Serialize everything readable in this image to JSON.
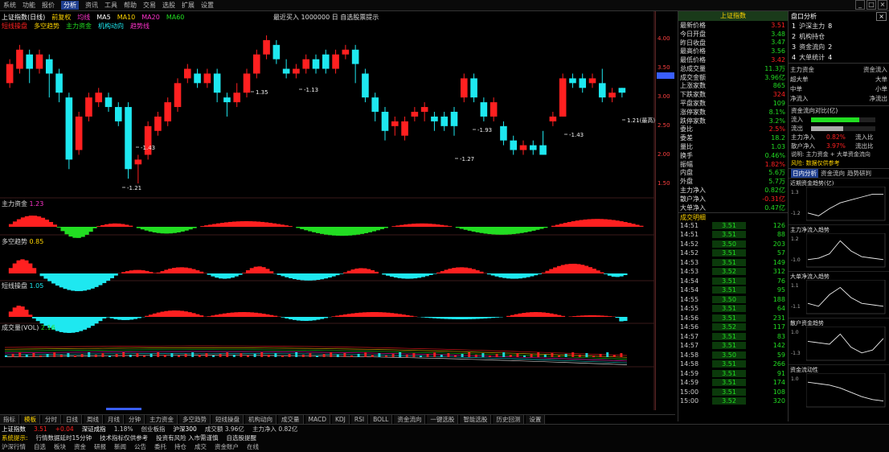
{
  "colors": {
    "up": "#ff2020",
    "down": "#1ee8f0",
    "green": "#22dd22",
    "yellow": "#ffd400",
    "magenta": "#ff33cc",
    "blue": "#3a5fff"
  },
  "topbar": {
    "items": [
      "系统",
      "功能",
      "报价",
      "分析",
      "资讯",
      "工具",
      "帮助",
      "交易",
      "选股",
      "扩展",
      "设置"
    ],
    "active": "分析",
    "window_buttons": [
      "_",
      "□",
      "×"
    ]
  },
  "chart": {
    "head_row1": [
      "上证指数(日线)",
      "前复权",
      "均线",
      "MA5",
      "MA10",
      "MA20",
      "MA60"
    ],
    "head_row2": [
      "短线操盘",
      "多空趋势",
      "主力资金",
      "机构动向",
      "趋势线"
    ],
    "title_center": "最近买入 1000000 日 自选股票提示",
    "candles": [
      {
        "o": 3.3,
        "c": 3.7,
        "h": 3.8,
        "l": 3.2
      },
      {
        "o": 3.6,
        "c": 4.0,
        "h": 4.1,
        "l": 3.5
      },
      {
        "o": 3.9,
        "c": 3.6,
        "h": 4.0,
        "l": 3.3
      },
      {
        "o": 3.6,
        "c": 3.9,
        "h": 4.0,
        "l": 3.5
      },
      {
        "o": 3.8,
        "c": 3.5,
        "h": 3.9,
        "l": 3.0
      },
      {
        "o": 3.5,
        "c": 3.1,
        "h": 3.6,
        "l": 2.9
      },
      {
        "o": 3.0,
        "c": 1.7,
        "h": 3.1,
        "l": 1.5
      },
      {
        "o": 1.9,
        "c": 2.6,
        "h": 2.7,
        "l": 1.8
      },
      {
        "o": 2.6,
        "c": 3.0,
        "h": 3.1,
        "l": 2.5
      },
      {
        "o": 2.9,
        "c": 3.1,
        "h": 3.2,
        "l": 2.8
      },
      {
        "o": 3.0,
        "c": 2.8,
        "h": 3.1,
        "l": 2.7
      },
      {
        "o": 2.8,
        "c": 2.5,
        "h": 2.9,
        "l": 2.4
      },
      {
        "o": 2.8,
        "c": 1.5,
        "h": 2.9,
        "l": 1.3
      },
      {
        "o": 1.6,
        "c": 1.7,
        "h": 1.8,
        "l": 1.2
      },
      {
        "o": 1.8,
        "c": 2.4,
        "h": 2.5,
        "l": 1.7
      },
      {
        "o": 2.3,
        "c": 2.6,
        "h": 2.7,
        "l": 2.2
      },
      {
        "o": 2.5,
        "c": 2.9,
        "h": 3.0,
        "l": 2.4
      },
      {
        "o": 2.8,
        "c": 3.3,
        "h": 3.4,
        "l": 2.7
      },
      {
        "o": 3.4,
        "c": 3.6,
        "h": 3.7,
        "l": 3.3
      },
      {
        "o": 3.5,
        "c": 3.3,
        "h": 3.6,
        "l": 3.2
      },
      {
        "o": 3.3,
        "c": 3.5,
        "h": 3.6,
        "l": 3.2
      },
      {
        "o": 3.5,
        "c": 3.1,
        "h": 3.6,
        "l": 2.9
      },
      {
        "o": 3.0,
        "c": 2.9,
        "h": 3.1,
        "l": 2.6
      },
      {
        "o": 2.9,
        "c": 3.1,
        "h": 3.3,
        "l": 2.8
      },
      {
        "o": 3.1,
        "c": 3.5,
        "h": 3.6,
        "l": 3.0
      },
      {
        "o": 3.5,
        "c": 3.9,
        "h": 4.0,
        "l": 3.4
      },
      {
        "o": 3.9,
        "c": 4.2,
        "h": 4.3,
        "l": 3.8
      },
      {
        "o": 4.1,
        "c": 3.8,
        "h": 4.2,
        "l": 3.7
      },
      {
        "o": 3.6,
        "c": 3.5,
        "h": 3.8,
        "l": 3.4
      },
      {
        "o": 3.5,
        "c": 3.6,
        "h": 3.7,
        "l": 3.4
      },
      {
        "o": 3.6,
        "c": 3.8,
        "h": 3.9,
        "l": 3.5
      },
      {
        "o": 3.8,
        "c": 3.6,
        "h": 3.9,
        "l": 3.5
      },
      {
        "o": 3.9,
        "c": 3.6,
        "h": 4.0,
        "l": 3.5
      },
      {
        "o": 3.6,
        "c": 3.9,
        "h": 4.0,
        "l": 3.5
      },
      {
        "o": 3.9,
        "c": 4.0,
        "h": 4.1,
        "l": 3.8
      },
      {
        "o": 4.0,
        "c": 3.7,
        "h": 4.1,
        "l": 3.3
      },
      {
        "o": 3.5,
        "c": 3.0,
        "h": 3.6,
        "l": 2.9
      },
      {
        "o": 3.0,
        "c": 2.7,
        "h": 3.1,
        "l": 2.5
      },
      {
        "o": 2.7,
        "c": 2.3,
        "h": 2.8,
        "l": 2.1
      },
      {
        "o": 2.4,
        "c": 2.5,
        "h": 2.6,
        "l": 2.2
      },
      {
        "o": 2.2,
        "c": 2.5,
        "h": 2.6,
        "l": 2.1
      },
      {
        "o": 2.6,
        "c": 2.7,
        "h": 2.8,
        "l": 2.5
      },
      {
        "o": 2.7,
        "c": 2.8,
        "h": 2.9,
        "l": 2.5
      },
      {
        "o": 2.6,
        "c": 2.5,
        "h": 2.7,
        "l": 2.3
      },
      {
        "o": 2.6,
        "c": 2.4,
        "h": 2.7,
        "l": 2.3
      },
      {
        "o": 2.7,
        "c": 2.4,
        "h": 2.8,
        "l": 2.2
      },
      {
        "o": 3.0,
        "c": 3.4,
        "h": 3.5,
        "l": 2.9
      },
      {
        "o": 3.4,
        "c": 3.0,
        "h": 3.5,
        "l": 2.9
      },
      {
        "o": 2.9,
        "c": 2.6,
        "h": 3.0,
        "l": 2.5
      },
      {
        "o": 2.6,
        "c": 2.9,
        "h": 3.0,
        "l": 2.5
      },
      {
        "o": 2.4,
        "c": 2.1,
        "h": 2.5,
        "l": 2.0
      },
      {
        "o": 2.1,
        "c": 1.9,
        "h": 2.2,
        "l": 1.8
      },
      {
        "o": 1.9,
        "c": 2.0,
        "h": 2.1,
        "l": 1.8
      },
      {
        "o": 2.0,
        "c": 1.9,
        "h": 2.1,
        "l": 1.8
      },
      {
        "o": 2.0,
        "c": 1.8,
        "h": 2.3,
        "l": 1.8
      },
      {
        "o": 2.5,
        "c": 2.6,
        "h": 2.7,
        "l": 2.4
      },
      {
        "o": 2.6,
        "c": 3.4,
        "h": 3.5,
        "l": 2.6
      },
      {
        "o": 3.4,
        "c": 3.3,
        "h": 3.5,
        "l": 3.2
      },
      {
        "o": 3.4,
        "c": 3.2,
        "h": 3.5,
        "l": 3.1
      },
      {
        "o": 3.3,
        "c": 3.4,
        "h": 3.5,
        "l": 3.2
      },
      {
        "o": 3.3,
        "c": 3.0,
        "h": 3.6,
        "l": 2.9
      },
      {
        "o": 3.0,
        "c": 3.1,
        "h": 3.2,
        "l": 2.9
      },
      {
        "o": 3.2,
        "c": 3.1,
        "h": 3.2,
        "l": 3.0
      }
    ],
    "labels": [
      "-1.21",
      "-1.43",
      "1.35",
      "-1.13",
      "-1.27",
      "-1.93",
      "-1.43",
      "1.21(最高)"
    ],
    "sub_labels": [
      "主力资金",
      "多空趋势",
      "短线操盘",
      "成交量(VOL)"
    ],
    "sub_values": [
      "1.23",
      "0.85",
      "1.05",
      "2.16"
    ]
  },
  "price_axis": {
    "ticks": [
      "4.00",
      "3.50",
      "3.00",
      "2.50",
      "2.00",
      "1.50"
    ]
  },
  "mid_panel": {
    "header": "上证指数",
    "info_rows": [
      {
        "k": "最新价格",
        "v": "3.51"
      },
      {
        "k": "今日开盘",
        "v": "3.48"
      },
      {
        "k": "昨日收盘",
        "v": "3.47"
      },
      {
        "k": "最高价格",
        "v": "3.56"
      },
      {
        "k": "最低价格",
        "v": "3.42"
      },
      {
        "k": "总成交量",
        "v": "11.3万"
      },
      {
        "k": "成交金额",
        "v": "3.96亿"
      },
      {
        "k": "上涨家数",
        "v": "865"
      },
      {
        "k": "下跌家数",
        "v": "324"
      },
      {
        "k": "平盘家数",
        "v": "109"
      },
      {
        "k": "涨停家数",
        "v": "8.1%"
      },
      {
        "k": "跌停家数",
        "v": "3.2%"
      },
      {
        "k": "委比",
        "v": "2.5%"
      },
      {
        "k": "委差",
        "v": "18.2"
      },
      {
        "k": "量比",
        "v": "1.03"
      },
      {
        "k": "换手",
        "v": "0.46%"
      },
      {
        "k": "振幅",
        "v": "1.82%"
      },
      {
        "k": "内盘",
        "v": "5.6万"
      },
      {
        "k": "外盘",
        "v": "5.7万"
      },
      {
        "k": "主力净入",
        "v": "0.82亿"
      },
      {
        "k": "散户净入",
        "v": "-0.31亿"
      },
      {
        "k": "大单净入",
        "v": "0.47亿"
      }
    ],
    "trade_header": "成交明细",
    "trades": [
      {
        "t": "14:51",
        "p": "3.51",
        "v": "126"
      },
      {
        "t": "14:51",
        "p": "3.51",
        "v": "88"
      },
      {
        "t": "14:52",
        "p": "3.50",
        "v": "203"
      },
      {
        "t": "14:52",
        "p": "3.51",
        "v": "57"
      },
      {
        "t": "14:53",
        "p": "3.51",
        "v": "149"
      },
      {
        "t": "14:53",
        "p": "3.52",
        "v": "312"
      },
      {
        "t": "14:54",
        "p": "3.51",
        "v": "76"
      },
      {
        "t": "14:54",
        "p": "3.51",
        "v": "95"
      },
      {
        "t": "14:55",
        "p": "3.50",
        "v": "188"
      },
      {
        "t": "14:55",
        "p": "3.51",
        "v": "64"
      },
      {
        "t": "14:56",
        "p": "3.51",
        "v": "231"
      },
      {
        "t": "14:56",
        "p": "3.52",
        "v": "117"
      },
      {
        "t": "14:57",
        "p": "3.51",
        "v": "83"
      },
      {
        "t": "14:57",
        "p": "3.51",
        "v": "142"
      },
      {
        "t": "14:58",
        "p": "3.50",
        "v": "59"
      },
      {
        "t": "14:58",
        "p": "3.51",
        "v": "266"
      },
      {
        "t": "14:59",
        "p": "3.51",
        "v": "91"
      },
      {
        "t": "14:59",
        "p": "3.51",
        "v": "174"
      },
      {
        "t": "15:00",
        "p": "3.51",
        "v": "108"
      },
      {
        "t": "15:00",
        "p": "3.52",
        "v": "320"
      }
    ],
    "bar_fills": [
      0.2,
      0.9,
      0.4,
      0.1,
      0.15,
      0.35,
      0.6,
      0.25
    ]
  },
  "right_panel": {
    "header": "盘口分析",
    "rank": [
      {
        "n": "1",
        "name": "沪深主力",
        "v": "8"
      },
      {
        "n": "2",
        "name": "机构持仓",
        "v": ""
      },
      {
        "n": "3",
        "name": "资金流向",
        "v": "2"
      },
      {
        "n": "4",
        "name": "大单统计",
        "v": "4"
      }
    ],
    "grid": [
      [
        "主力资金",
        "资金流入"
      ],
      [
        "超大单",
        "大单"
      ],
      [
        "中单",
        "小单"
      ],
      [
        "净流入",
        "净流出"
      ]
    ],
    "bar_title": "资金流向对比(亿)",
    "bars": [
      {
        "label": "流入",
        "fill": 0.75
      },
      {
        "label": "流出",
        "fill": 0.5
      }
    ],
    "stats": [
      {
        "k": "主力净入",
        "v": "0.82%",
        "v2": "流入比"
      },
      {
        "k": "散户净入",
        "v": "3.97%",
        "v2": "流出比"
      }
    ],
    "note1": "说明: 主力资金 + 大单资金流向",
    "note2": "风险: 数据仅供参考",
    "tabs": [
      "日内分析",
      "资金流向",
      "趋势研判"
    ],
    "minis": [
      {
        "title": "近期资金趋势(亿)",
        "ticks": [
          "1.3",
          "-1.2"
        ],
        "pts": [
          0.2,
          0.1,
          0.35,
          0.55,
          0.65,
          0.75,
          0.85,
          0.85
        ]
      },
      {
        "title": "主力净流入趋势",
        "ticks": [
          "1.2",
          "-1.0"
        ],
        "pts": [
          0.2,
          0.25,
          0.4,
          0.85,
          0.5,
          0.3,
          0.25,
          0.2
        ]
      },
      {
        "title": "大单净流入趋势",
        "ticks": [
          "1.1",
          "-1.1"
        ],
        "pts": [
          0.3,
          0.2,
          0.6,
          0.85,
          0.5,
          0.3,
          0.25,
          0.2
        ]
      },
      {
        "title": "散户资金趋势",
        "ticks": [
          "1.0",
          "-1.3"
        ],
        "pts": [
          0.6,
          0.55,
          0.5,
          0.85,
          0.4,
          0.2,
          0.3,
          0.7
        ]
      },
      {
        "title": "资金流动性",
        "ticks": [
          "1.0"
        ],
        "pts": [
          0.8,
          0.75,
          0.7,
          0.6,
          0.45,
          0.3,
          0.2,
          0.15
        ]
      }
    ]
  },
  "bottom_tabs": [
    "指标",
    "模板",
    "分时",
    "日线",
    "周线",
    "月线",
    "分钟",
    "主力资金",
    "多空趋势",
    "短线操盘",
    "机构动向",
    "成交量",
    "MACD",
    "KDJ",
    "RSI",
    "BOLL",
    "资金流向",
    "一键选股",
    "智能选股",
    "历史回测",
    "设置"
  ],
  "statusbar": {
    "row1": [
      "上证指数",
      "3.51",
      "+0.04",
      "深证成指",
      "1.18%",
      "创业板指",
      "沪深300",
      "成交额 3.96亿",
      "主力净入 0.82亿"
    ],
    "row2": [
      "系统提示:",
      "行情数据延时15分钟",
      "技术指标仅供参考",
      "投资有风险 入市需谨慎",
      "自选股提醒"
    ],
    "row3": [
      "沪深行情",
      "自选",
      "板块",
      "资金",
      "研报",
      "新闻",
      "公告",
      "委托",
      "持仓",
      "成交",
      "资金账户",
      "在线"
    ]
  }
}
